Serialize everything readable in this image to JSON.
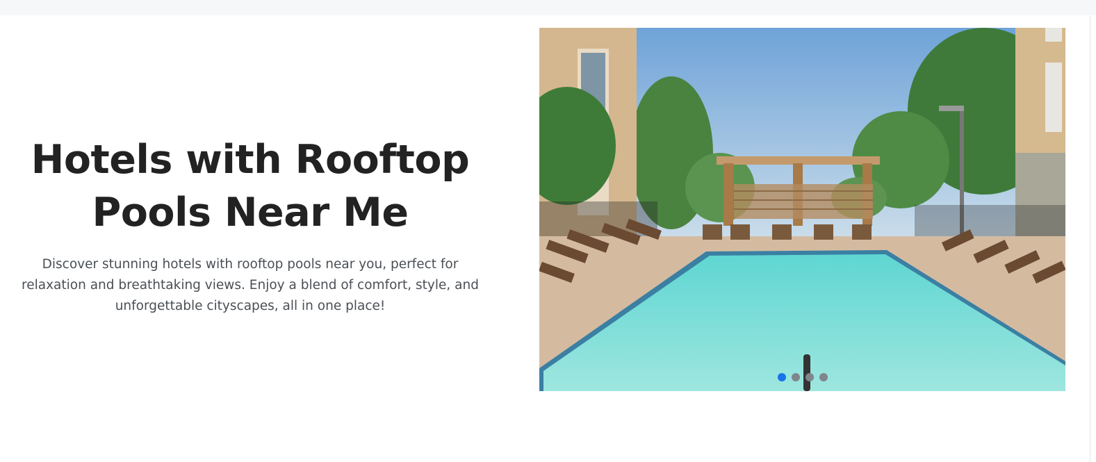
{
  "hero": {
    "title_line1": "Hotels with Rooftop",
    "title_line2": "Pools Near Me",
    "description": "Discover stunning hotels with rooftop pools near you, perfect for relaxation and breathtaking views. Enjoy a blend of comfort, style, and unforgettable cityscapes, all in one place!"
  },
  "carousel": {
    "image_subject": "hotel outdoor pool with lounge chairs and pergola",
    "slide_count": 4,
    "active_slide": 1,
    "colors": {
      "active_indicator": "#1a73e8",
      "inactive_indicator": "#7f868c"
    }
  }
}
